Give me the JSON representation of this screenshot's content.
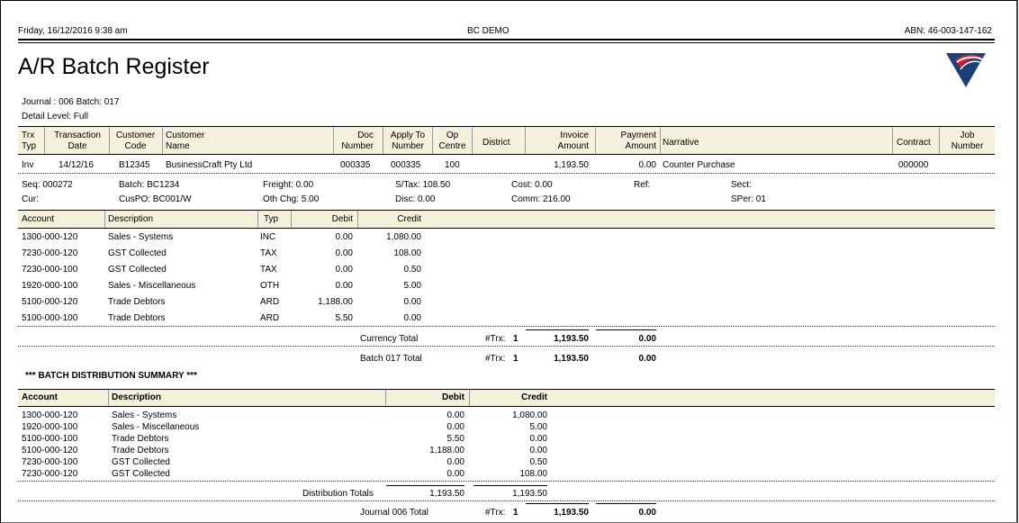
{
  "header": {
    "datetime": "Friday, 16/12/2016  9:38 am",
    "company": "BC DEMO",
    "abn": "ABN: 46-003-147-162",
    "title": "A/R Batch Register",
    "journal_batch": "Journal : 006  Batch: 017",
    "detail_level": "Detail Level: Full"
  },
  "main_columns": {
    "trx_typ": [
      "Trx",
      "Typ"
    ],
    "trans_date": [
      "Transaction",
      "Date"
    ],
    "cust_code": [
      "Customer",
      "Code"
    ],
    "cust_name": [
      "Customer",
      "Name"
    ],
    "doc_number": [
      "Doc",
      "Number"
    ],
    "apply_to": [
      "Apply To",
      "Number"
    ],
    "op_centre": [
      "Op",
      "Centre"
    ],
    "district": "District",
    "invoice_amount": [
      "Invoice",
      "Amount"
    ],
    "payment_amount": [
      "Payment",
      "Amount"
    ],
    "narrative": "Narrative",
    "contract": "Contract",
    "job_number": [
      "Job",
      "Number"
    ]
  },
  "transaction": {
    "typ": "Inv",
    "date": "14/12/16",
    "code": "B12345",
    "name": "BusinessCraft Pty Ltd",
    "doc": "000335",
    "apply_to": "000335",
    "op_centre": "100",
    "district": "",
    "invoice": "1,193.50",
    "payment": "0.00",
    "narrative": "Counter Purchase",
    "contract": "000000",
    "job": ""
  },
  "details": {
    "seq": "Seq: 000272",
    "batch": "Batch: BC1234",
    "freight": "Freight: 0.00",
    "stax": "S/Tax: 108.50",
    "cost": "Cost: 0.00",
    "ref": "Ref:",
    "sect": "Sect:",
    "cur": "Cur:",
    "cuspo": "CusPO: BC001/W",
    "othchg": "Oth Chg: 5.00",
    "disc": "Disc: 0.00",
    "comm": "Comm: 216.00",
    "sper": "SPer: 01"
  },
  "gl_columns": {
    "account": "Account",
    "description": "Description",
    "typ": "Typ",
    "debit": "Debit",
    "credit": "Credit"
  },
  "gl_rows": [
    {
      "account": "1300-000-120",
      "description": "Sales - Systems",
      "typ": "INC",
      "debit": "0.00",
      "credit": "1,080.00"
    },
    {
      "account": "7230-000-120",
      "description": "GST Collected",
      "typ": "TAX",
      "debit": "0.00",
      "credit": "108.00"
    },
    {
      "account": "7230-000-100",
      "description": "GST Collected",
      "typ": "TAX",
      "debit": "0.00",
      "credit": "0.50"
    },
    {
      "account": "1920-000-100",
      "description": "Sales - Miscellaneous",
      "typ": "OTH",
      "debit": "0.00",
      "credit": "5.00"
    },
    {
      "account": "5100-000-120",
      "description": "Trade Debtors",
      "typ": "ARD",
      "debit": "1,188.00",
      "credit": "0.00"
    },
    {
      "account": "5100-000-100",
      "description": "Trade Debtors",
      "typ": "ARD",
      "debit": "5.50",
      "credit": "0.00"
    }
  ],
  "currency_total": {
    "label": "Currency Total",
    "trx_label": "#Trx:",
    "trx": "1",
    "invoice": "1,193.50",
    "payment": "0.00"
  },
  "batch_total": {
    "label": "Batch 017 Total",
    "trx_label": "#Trx:",
    "trx": "1",
    "invoice": "1,193.50",
    "payment": "0.00"
  },
  "summary": {
    "title": "*** BATCH DISTRIBUTION SUMMARY ***",
    "columns": {
      "account": "Account",
      "description": "Description",
      "debit": "Debit",
      "credit": "Credit"
    },
    "rows": [
      {
        "account": "1300-000-120",
        "description": "Sales - Systems",
        "debit": "0.00",
        "credit": "1,080.00"
      },
      {
        "account": "1920-000-100",
        "description": "Sales - Miscellaneous",
        "debit": "0.00",
        "credit": "5.00"
      },
      {
        "account": "5100-000-100",
        "description": "Trade Debtors",
        "debit": "5.50",
        "credit": "0.00"
      },
      {
        "account": "5100-000-120",
        "description": "Trade Debtors",
        "debit": "1,188.00",
        "credit": "0.00"
      },
      {
        "account": "7230-000-100",
        "description": "GST Collected",
        "debit": "0.00",
        "credit": "0.50"
      },
      {
        "account": "7230-000-120",
        "description": "GST Collected",
        "debit": "0.00",
        "credit": "108.00"
      }
    ],
    "totals_label": "Distribution Totals",
    "total_debit": "1,193.50",
    "total_credit": "1,193.50"
  },
  "journal_total": {
    "label": "Journal 006 Total",
    "trx_label": "#Trx:",
    "trx": "1",
    "invoice": "1,193.50",
    "payment": "0.00"
  },
  "colors": {
    "band": "#f5f0dc",
    "logo_blue": "#1c3f7a",
    "logo_red": "#d42027"
  },
  "logo_icon": "company-logo-icon"
}
